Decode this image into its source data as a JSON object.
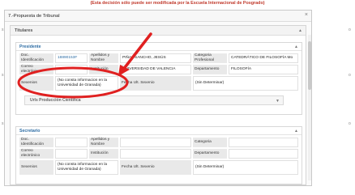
{
  "notice": "(Esta decisión sólo puede ser modificada por la Escuela Internacional de Posgrado)",
  "background": {
    "left_labels": [
      "s",
      "s",
      "s"
    ],
    "right_labels": [
      "o",
      "o",
      "o"
    ]
  },
  "modal": {
    "title": "7.-Propuesta de Tribunal",
    "close": "×"
  },
  "titulares": {
    "heading": "Titulares",
    "caret": "▲"
  },
  "presidente": {
    "title": "Presidente",
    "caret": "▲",
    "doc_label": "Doc. Identificación",
    "doc_value": "18890153F",
    "apellidos_label": "Apellidos y Nombre",
    "apellidos_value": "PIÑAL SANCHO, JESÚS",
    "categoria_label": "Categoria Profesional",
    "categoria_value": "CATEDRÁTICO DE FILOSOFÍA Mo",
    "correo_label": "Correo electrónico",
    "correo_value": "",
    "institucion_label": "Institución",
    "institucion_value": "UNIVERSIDAD DE VALENCIA",
    "departamento_label": "Departamento",
    "departamento_value": "FILOSOFÍA",
    "sexenios_label": "Sexenios",
    "sexenios_value": "(No consta informacion en la Universidad de Granada)",
    "fecha_label": "Fecha Ult. Sexenio",
    "fecha_value": "(Sin Determinar)",
    "urls_label": "Urls Producción Científica",
    "urls_caret": "▼"
  },
  "secretario": {
    "title": "Secretario",
    "caret": "▲",
    "doc_label": "Doc. Identificación",
    "doc_value": "",
    "apellidos_label": "Apellidos y Nombre",
    "apellidos_value": "",
    "categoria_label": "Categoria",
    "categoria_value": "",
    "correo_label": "Correo electrónico",
    "correo_value": "",
    "institucion_label": "Institución",
    "institucion_value": "",
    "departamento_label": "Departamento",
    "departamento_value": "",
    "sexenios_label": "Sexenios",
    "sexenios_value": "(No consta informacion en la Universidad de Granada)",
    "fecha_label": "Fecha Ult. Sexenio",
    "fecha_value": "(Sin Determinar)"
  },
  "annotation_color": "#e02020"
}
